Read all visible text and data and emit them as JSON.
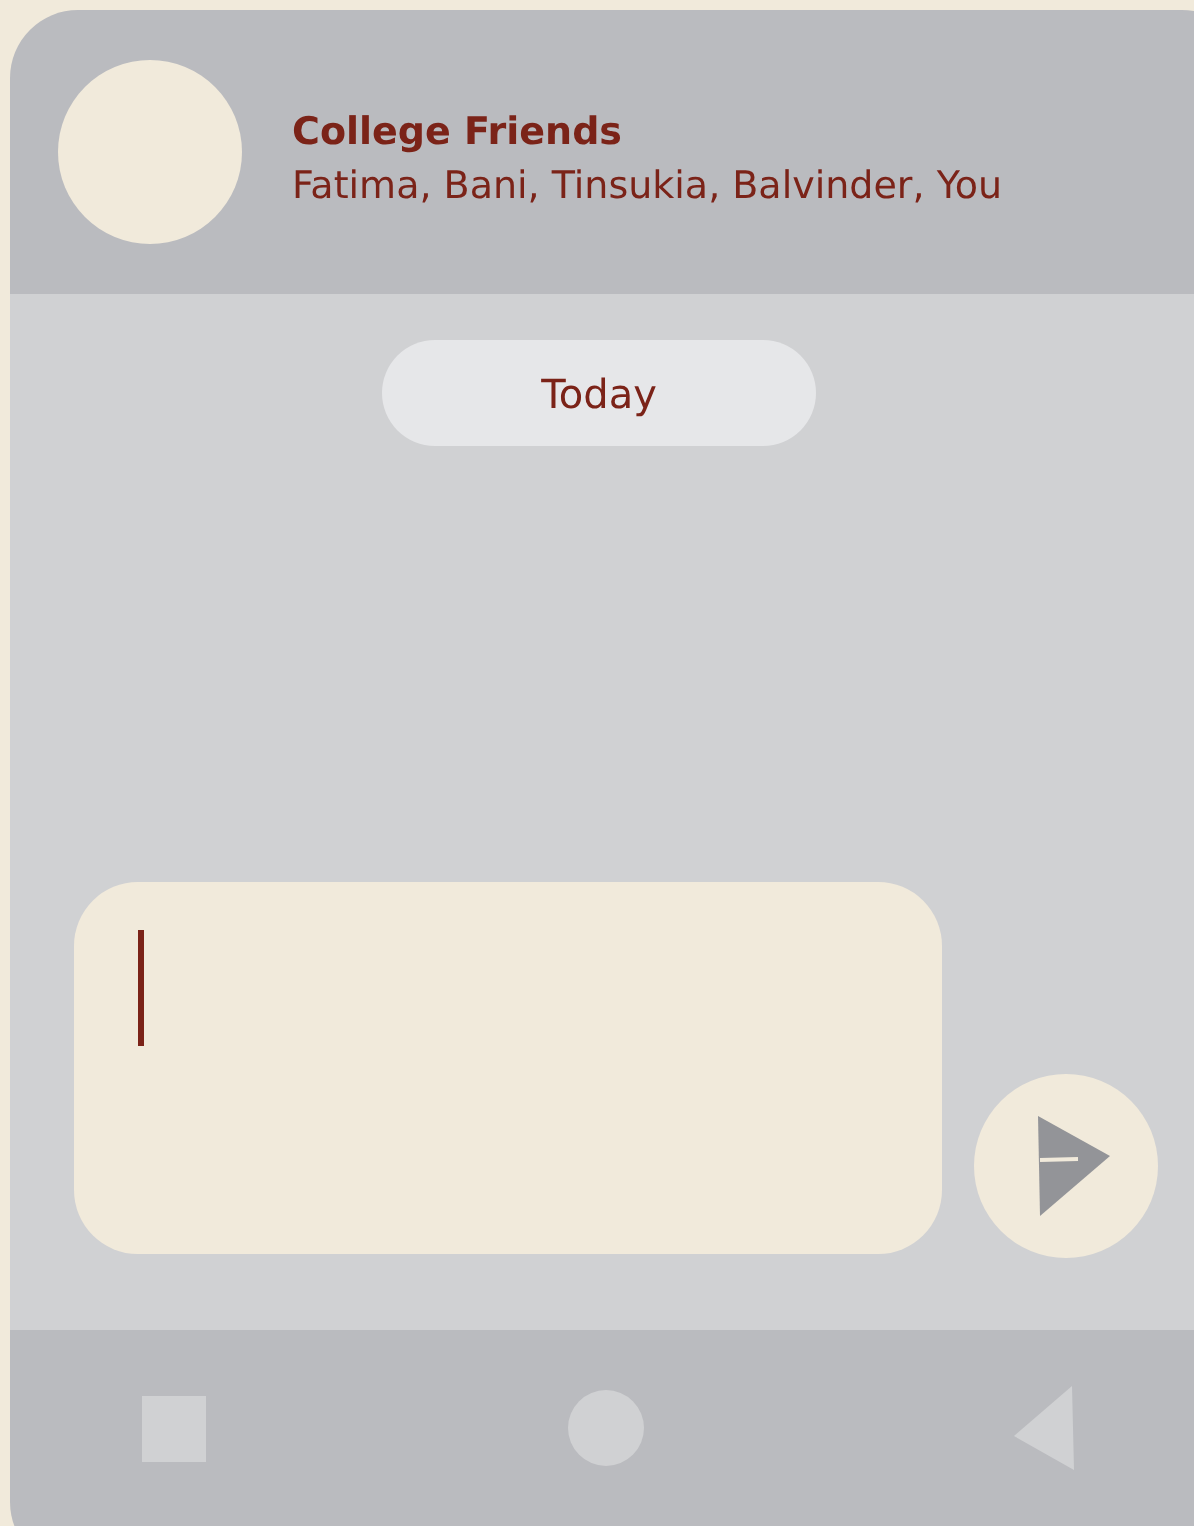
{
  "header": {
    "title": "College Friends",
    "members": "Fatima, Bani, Tinsukia, Balvinder, You"
  },
  "date_chip": "Today",
  "composer": {
    "focused": true
  },
  "nav_bar": [
    {
      "kind": "square"
    },
    {
      "kind": "circle"
    },
    {
      "kind": "triangle"
    }
  ]
}
